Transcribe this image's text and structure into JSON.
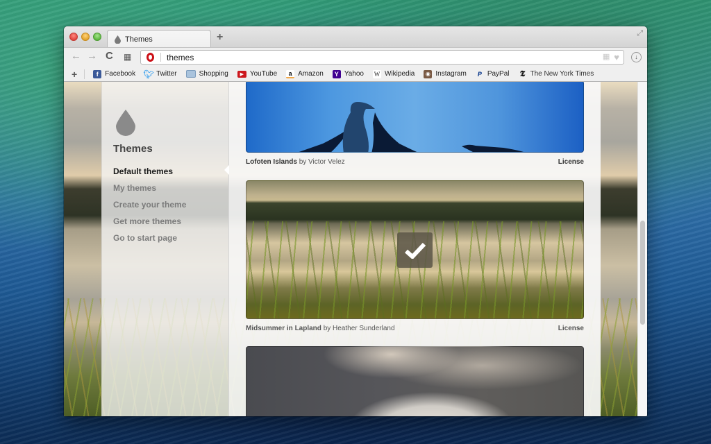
{
  "window": {
    "tab_title": "Themes",
    "new_tab_symbol": "+",
    "fullscreen_symbol": "⤢"
  },
  "toolbar": {
    "back_symbol": "←",
    "forward_symbol": "→",
    "reload_symbol": "C",
    "speed_dial_symbol": "▦",
    "address_value": "themes",
    "download_symbol": "↓"
  },
  "bookmarks": {
    "add_symbol": "+",
    "items": [
      {
        "label": "Facebook",
        "icon": "facebook-icon",
        "glyph": "f",
        "color": "#3b5998"
      },
      {
        "label": "Twitter",
        "icon": "twitter-icon",
        "glyph": "t",
        "color": "#55acee"
      },
      {
        "label": "Shopping",
        "icon": "folder-icon",
        "glyph": "",
        "color": "#9fbad6"
      },
      {
        "label": "YouTube",
        "icon": "youtube-icon",
        "glyph": "▶",
        "color": "#cc181e"
      },
      {
        "label": "Amazon",
        "icon": "amazon-icon",
        "glyph": "a",
        "color": "#f3a847"
      },
      {
        "label": "Yahoo",
        "icon": "yahoo-icon",
        "glyph": "Y",
        "color": "#400191"
      },
      {
        "label": "Wikipedia",
        "icon": "wikipedia-icon",
        "glyph": "W",
        "color": "#ffffff"
      },
      {
        "label": "Instagram",
        "icon": "instagram-icon",
        "glyph": "◉",
        "color": "#7a5a44"
      },
      {
        "label": "PayPal",
        "icon": "paypal-icon",
        "glyph": "P",
        "color": "#003087"
      },
      {
        "label": "The New York Times",
        "icon": "nyt-icon",
        "glyph": "T",
        "color": "#111111"
      }
    ]
  },
  "sidebar": {
    "title": "Themes",
    "items": [
      {
        "label": "Default themes",
        "active": true
      },
      {
        "label": "My themes",
        "active": false
      },
      {
        "label": "Create your theme",
        "active": false
      },
      {
        "label": "Get more themes",
        "active": false
      },
      {
        "label": "Go to start page",
        "active": false
      }
    ]
  },
  "themes": [
    {
      "name": "Lofoten Islands",
      "by": "by Victor Velez",
      "license": "License",
      "selected": false
    },
    {
      "name": "Midsummer in Lapland",
      "by": "by Heather Sunderland",
      "license": "License",
      "selected": true
    },
    {
      "name": "",
      "by": "",
      "license": "",
      "selected": false
    }
  ],
  "scrollbar": {
    "position_fraction": 0.45
  }
}
